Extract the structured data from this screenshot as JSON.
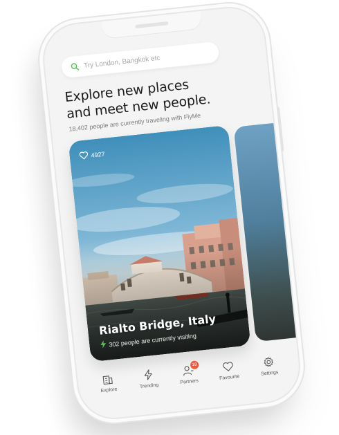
{
  "search": {
    "placeholder": "Try London, Bangkok etc",
    "value": ""
  },
  "header": {
    "headline_line1": "Explore new places",
    "headline_line2": "and meet new people.",
    "subline": "18,402 people are currently traveling with FlyMe"
  },
  "featured_card": {
    "likes": "4927",
    "title": "Rialto Bridge, Italy",
    "visitors": "302 people are currently visiting"
  },
  "tabbar": {
    "items": [
      {
        "label": "Explore",
        "icon": "building-icon"
      },
      {
        "label": "Trending",
        "icon": "lightning-icon"
      },
      {
        "label": "Partners",
        "icon": "user-add-icon",
        "badge": "10"
      },
      {
        "label": "Favourite",
        "icon": "heart-icon"
      },
      {
        "label": "Settings",
        "icon": "gear-icon"
      }
    ]
  },
  "colors": {
    "accent_green": "#5cc35a",
    "badge_red": "#f2553a",
    "text_dark": "#1d1d1d",
    "text_muted": "#7a7c7b"
  }
}
